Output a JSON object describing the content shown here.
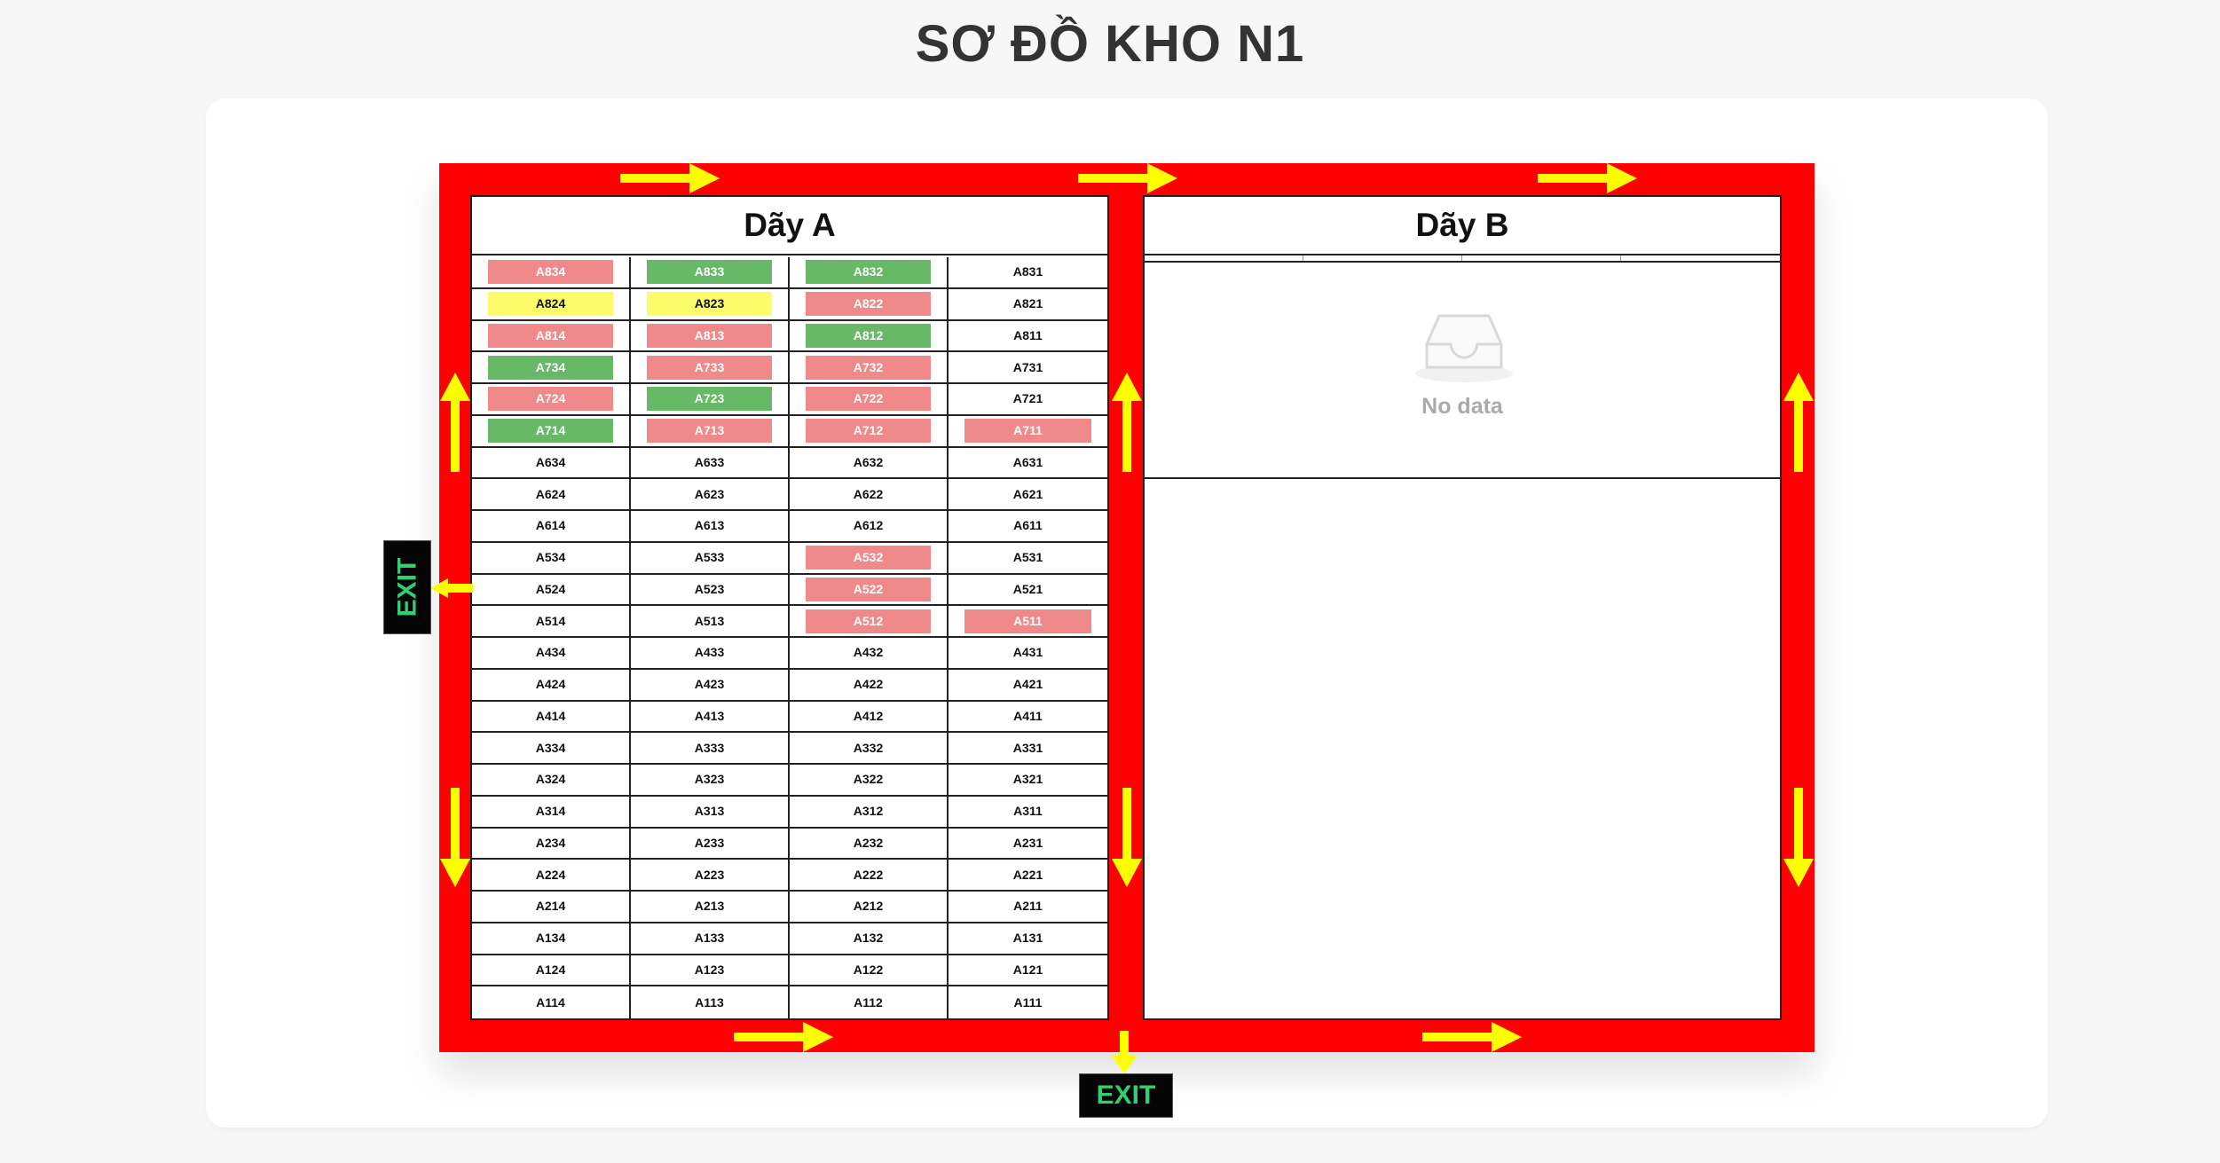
{
  "page": {
    "title": "SƠ ĐỒ KHO N1"
  },
  "warehouse": {
    "zone_a": {
      "title": "Dãy A",
      "rows": [
        [
          {
            "code": "A834",
            "status": "red"
          },
          {
            "code": "A833",
            "status": "green"
          },
          {
            "code": "A832",
            "status": "green"
          },
          {
            "code": "A831",
            "status": "empty"
          }
        ],
        [
          {
            "code": "A824",
            "status": "yellow"
          },
          {
            "code": "A823",
            "status": "yellow"
          },
          {
            "code": "A822",
            "status": "red"
          },
          {
            "code": "A821",
            "status": "empty"
          }
        ],
        [
          {
            "code": "A814",
            "status": "red"
          },
          {
            "code": "A813",
            "status": "red"
          },
          {
            "code": "A812",
            "status": "green"
          },
          {
            "code": "A811",
            "status": "empty"
          }
        ],
        [
          {
            "code": "A734",
            "status": "green"
          },
          {
            "code": "A733",
            "status": "red"
          },
          {
            "code": "A732",
            "status": "red"
          },
          {
            "code": "A731",
            "status": "empty"
          }
        ],
        [
          {
            "code": "A724",
            "status": "red"
          },
          {
            "code": "A723",
            "status": "green"
          },
          {
            "code": "A722",
            "status": "red"
          },
          {
            "code": "A721",
            "status": "empty"
          }
        ],
        [
          {
            "code": "A714",
            "status": "green"
          },
          {
            "code": "A713",
            "status": "red"
          },
          {
            "code": "A712",
            "status": "red"
          },
          {
            "code": "A711",
            "status": "red"
          }
        ],
        [
          {
            "code": "A634",
            "status": "empty"
          },
          {
            "code": "A633",
            "status": "empty"
          },
          {
            "code": "A632",
            "status": "empty"
          },
          {
            "code": "A631",
            "status": "empty"
          }
        ],
        [
          {
            "code": "A624",
            "status": "empty"
          },
          {
            "code": "A623",
            "status": "empty"
          },
          {
            "code": "A622",
            "status": "empty"
          },
          {
            "code": "A621",
            "status": "empty"
          }
        ],
        [
          {
            "code": "A614",
            "status": "empty"
          },
          {
            "code": "A613",
            "status": "empty"
          },
          {
            "code": "A612",
            "status": "empty"
          },
          {
            "code": "A611",
            "status": "empty"
          }
        ],
        [
          {
            "code": "A534",
            "status": "empty"
          },
          {
            "code": "A533",
            "status": "empty"
          },
          {
            "code": "A532",
            "status": "red"
          },
          {
            "code": "A531",
            "status": "empty"
          }
        ],
        [
          {
            "code": "A524",
            "status": "empty"
          },
          {
            "code": "A523",
            "status": "empty"
          },
          {
            "code": "A522",
            "status": "red"
          },
          {
            "code": "A521",
            "status": "empty"
          }
        ],
        [
          {
            "code": "A514",
            "status": "empty"
          },
          {
            "code": "A513",
            "status": "empty"
          },
          {
            "code": "A512",
            "status": "red"
          },
          {
            "code": "A511",
            "status": "red"
          }
        ],
        [
          {
            "code": "A434",
            "status": "empty"
          },
          {
            "code": "A433",
            "status": "empty"
          },
          {
            "code": "A432",
            "status": "empty"
          },
          {
            "code": "A431",
            "status": "empty"
          }
        ],
        [
          {
            "code": "A424",
            "status": "empty"
          },
          {
            "code": "A423",
            "status": "empty"
          },
          {
            "code": "A422",
            "status": "empty"
          },
          {
            "code": "A421",
            "status": "empty"
          }
        ],
        [
          {
            "code": "A414",
            "status": "empty"
          },
          {
            "code": "A413",
            "status": "empty"
          },
          {
            "code": "A412",
            "status": "empty"
          },
          {
            "code": "A411",
            "status": "empty"
          }
        ],
        [
          {
            "code": "A334",
            "status": "empty"
          },
          {
            "code": "A333",
            "status": "empty"
          },
          {
            "code": "A332",
            "status": "empty"
          },
          {
            "code": "A331",
            "status": "empty"
          }
        ],
        [
          {
            "code": "A324",
            "status": "empty"
          },
          {
            "code": "A323",
            "status": "empty"
          },
          {
            "code": "A322",
            "status": "empty"
          },
          {
            "code": "A321",
            "status": "empty"
          }
        ],
        [
          {
            "code": "A314",
            "status": "empty"
          },
          {
            "code": "A313",
            "status": "empty"
          },
          {
            "code": "A312",
            "status": "empty"
          },
          {
            "code": "A311",
            "status": "empty"
          }
        ],
        [
          {
            "code": "A234",
            "status": "empty"
          },
          {
            "code": "A233",
            "status": "empty"
          },
          {
            "code": "A232",
            "status": "empty"
          },
          {
            "code": "A231",
            "status": "empty"
          }
        ],
        [
          {
            "code": "A224",
            "status": "empty"
          },
          {
            "code": "A223",
            "status": "empty"
          },
          {
            "code": "A222",
            "status": "empty"
          },
          {
            "code": "A221",
            "status": "empty"
          }
        ],
        [
          {
            "code": "A214",
            "status": "empty"
          },
          {
            "code": "A213",
            "status": "empty"
          },
          {
            "code": "A212",
            "status": "empty"
          },
          {
            "code": "A211",
            "status": "empty"
          }
        ],
        [
          {
            "code": "A134",
            "status": "empty"
          },
          {
            "code": "A133",
            "status": "empty"
          },
          {
            "code": "A132",
            "status": "empty"
          },
          {
            "code": "A131",
            "status": "empty"
          }
        ],
        [
          {
            "code": "A124",
            "status": "empty"
          },
          {
            "code": "A123",
            "status": "empty"
          },
          {
            "code": "A122",
            "status": "empty"
          },
          {
            "code": "A121",
            "status": "empty"
          }
        ],
        [
          {
            "code": "A114",
            "status": "empty"
          },
          {
            "code": "A113",
            "status": "empty"
          },
          {
            "code": "A112",
            "status": "empty"
          },
          {
            "code": "A111",
            "status": "empty"
          }
        ]
      ]
    },
    "zone_b": {
      "title": "Dãy B",
      "empty_text": "No data",
      "empty_icon": "inbox-icon"
    },
    "exit_label": "EXIT",
    "arrow_icon": "yellow-arrow-icon"
  },
  "colors": {
    "status_red": "#f08a8a",
    "status_green": "#67b867",
    "status_yellow": "#fcfc6a",
    "corridor": "#ff0000",
    "arrow": "#ffff00",
    "exit_text": "#2fcf72"
  }
}
